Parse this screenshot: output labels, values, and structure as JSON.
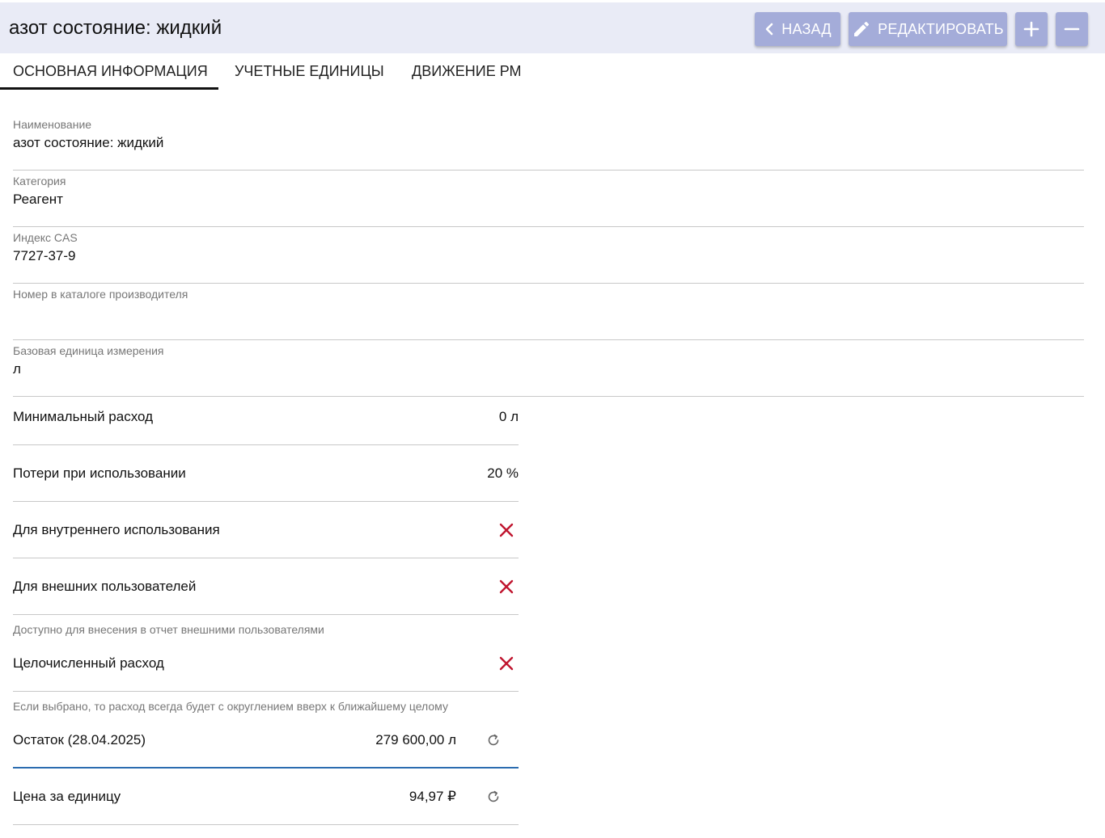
{
  "header": {
    "title": "азот состояние: жидкий",
    "back_label": "НАЗАД",
    "edit_label": "РЕДАКТИРОВАТЬ",
    "accent_color": "#a4acd9"
  },
  "tabs": [
    {
      "label": "ОСНОВНАЯ ИНФОРМАЦИЯ",
      "active": true
    },
    {
      "label": "УЧЕТНЫЕ ЕДИНИЦЫ",
      "active": false
    },
    {
      "label": "ДВИЖЕНИЕ РМ",
      "active": false
    }
  ],
  "fields": [
    {
      "label": "Наименование",
      "value": "азот состояние: жидкий"
    },
    {
      "label": "Категория",
      "value": "Реагент"
    },
    {
      "label": "Индекс CAS",
      "value": "7727-37-9"
    },
    {
      "label": "Номер в каталоге производителя",
      "value": ""
    },
    {
      "label": "Базовая единица измерения",
      "value": "л"
    }
  ],
  "rows": {
    "min_consumption": {
      "label": "Минимальный расход",
      "value": "0 л"
    },
    "usage_loss": {
      "label": "Потери при использовании",
      "value": "20 %"
    },
    "internal_use": {
      "label": "Для внутреннего использования",
      "value": false
    },
    "external_users": {
      "label": "Для внешних пользователей",
      "value": false
    },
    "external_hint": "Доступно для внесения в отчет внешними пользователями",
    "integer_consumption": {
      "label": "Целочисленный расход",
      "value": false
    },
    "integer_hint": "Если выбрано, то расход всегда будет с округлением вверх к ближайшему целому",
    "balance": {
      "label": "Остаток (28.04.2025)",
      "value": "279 600,00 л"
    },
    "unit_price": {
      "label": "Цена за единицу",
      "value": "94,97 ₽"
    }
  },
  "colors": {
    "false_icon": "#c0152f",
    "active_underline": "#2b6cb0"
  }
}
